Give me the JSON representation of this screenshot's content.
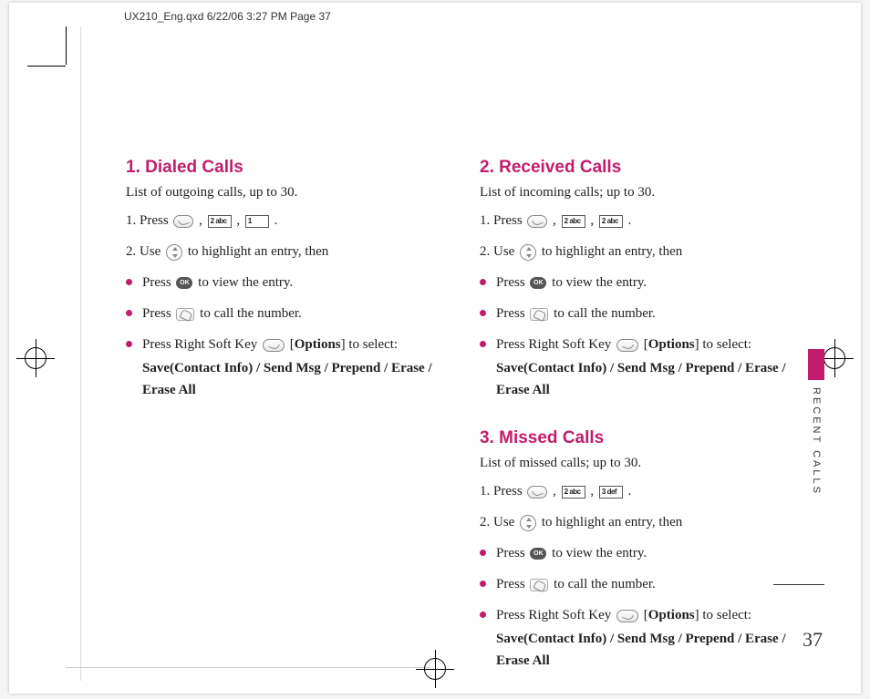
{
  "print_header": "UX210_Eng.qxd  6/22/06  3:27 PM  Page 37",
  "side_label": "RECENT CALLS",
  "page_number": "37",
  "keys": {
    "k2": "2 abc",
    "k1": "1",
    "k3": "3 def",
    "ok": "OK"
  },
  "sections": {
    "dialed": {
      "title": "1. Dialed Calls",
      "desc": "List of outgoing calls, up to 30.",
      "step1_a": "1. Press ",
      "step1_b": " , ",
      "step1_c": " , ",
      "step1_d": " .",
      "step2_a": "2. Use ",
      "step2_b": " to highlight an entry, then",
      "b1_a": "Press ",
      "b1_b": " to view the entry.",
      "b2_a": "Press ",
      "b2_b": " to call the number.",
      "b3_a": "Press Right Soft Key ",
      "b3_b": " [",
      "b3_opt": "Options",
      "b3_c": "] to select:",
      "b3_sub": "Save(Contact Info) / Send Msg / Prepend / Erase / Erase All"
    },
    "received": {
      "title": "2. Received Calls",
      "desc": "List of incoming calls; up to 30.",
      "step1_a": "1. Press ",
      "step1_b": " , ",
      "step1_c": " , ",
      "step1_d": " .",
      "step2_a": "2. Use ",
      "step2_b": " to highlight an entry, then",
      "b1_a": "Press ",
      "b1_b": " to view the entry.",
      "b2_a": "Press ",
      "b2_b": " to call the number.",
      "b3_a": "Press Right Soft Key ",
      "b3_b": " [",
      "b3_opt": "Options",
      "b3_c": "] to select:",
      "b3_sub": "Save(Contact Info) / Send Msg / Prepend / Erase / Erase All"
    },
    "missed": {
      "title": "3. Missed Calls",
      "desc": "List of missed calls; up to 30.",
      "step1_a": "1. Press ",
      "step1_b": " , ",
      "step1_c": " , ",
      "step1_d": " .",
      "step2_a": "2. Use ",
      "step2_b": " to highlight an entry, then",
      "b1_a": "Press ",
      "b1_b": " to view the entry.",
      "b2_a": "Press ",
      "b2_b": " to call the number.",
      "b3_a": "Press Right Soft Key ",
      "b3_b": " [",
      "b3_opt": "Options",
      "b3_c": "] to select:",
      "b3_sub": "Save(Contact Info) / Send Msg / Prepend / Erase / Erase All"
    }
  }
}
